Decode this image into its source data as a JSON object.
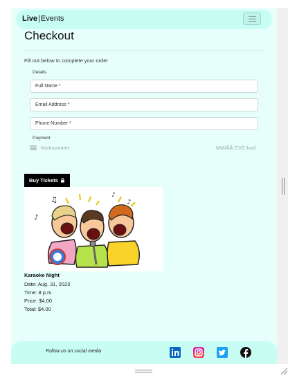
{
  "navbar": {
    "brand_bold": "Live",
    "brand_sep": "|",
    "brand_rest": "Events",
    "menu_icon": "hamburger-icon"
  },
  "checkout": {
    "title": "Checkout",
    "intro": "Fill out below to complete your order",
    "details_label": "Details",
    "full_name": "Full Name *",
    "email": "Email Address *",
    "phone": "Phone Number *",
    "payment_label": "Payment",
    "card_number_placeholder": "Kortnummer",
    "card_expiry_cvc_placeholder": "MM/ÅÅ CVC-kod",
    "card_icon": "credit-card-icon"
  },
  "buy_button": {
    "label": "Buy Tickets",
    "icon": "lock-icon"
  },
  "event": {
    "image": "karaoke-singers-illustration",
    "name": "Karaoke Night",
    "date": "Date: Aug. 31, 2023",
    "time": "Time: 8 p.m.",
    "price": "Price: $4.00",
    "total": "Total: $4.00"
  },
  "footer": {
    "follow_text": "Follow us on social media",
    "social": [
      "linkedin-icon",
      "instagram-icon",
      "twitter-icon",
      "facebook-icon"
    ]
  },
  "colors": {
    "page_bg": "#e6fffa",
    "nav_bg": "#c8fdf3",
    "button_bg": "#000000"
  }
}
